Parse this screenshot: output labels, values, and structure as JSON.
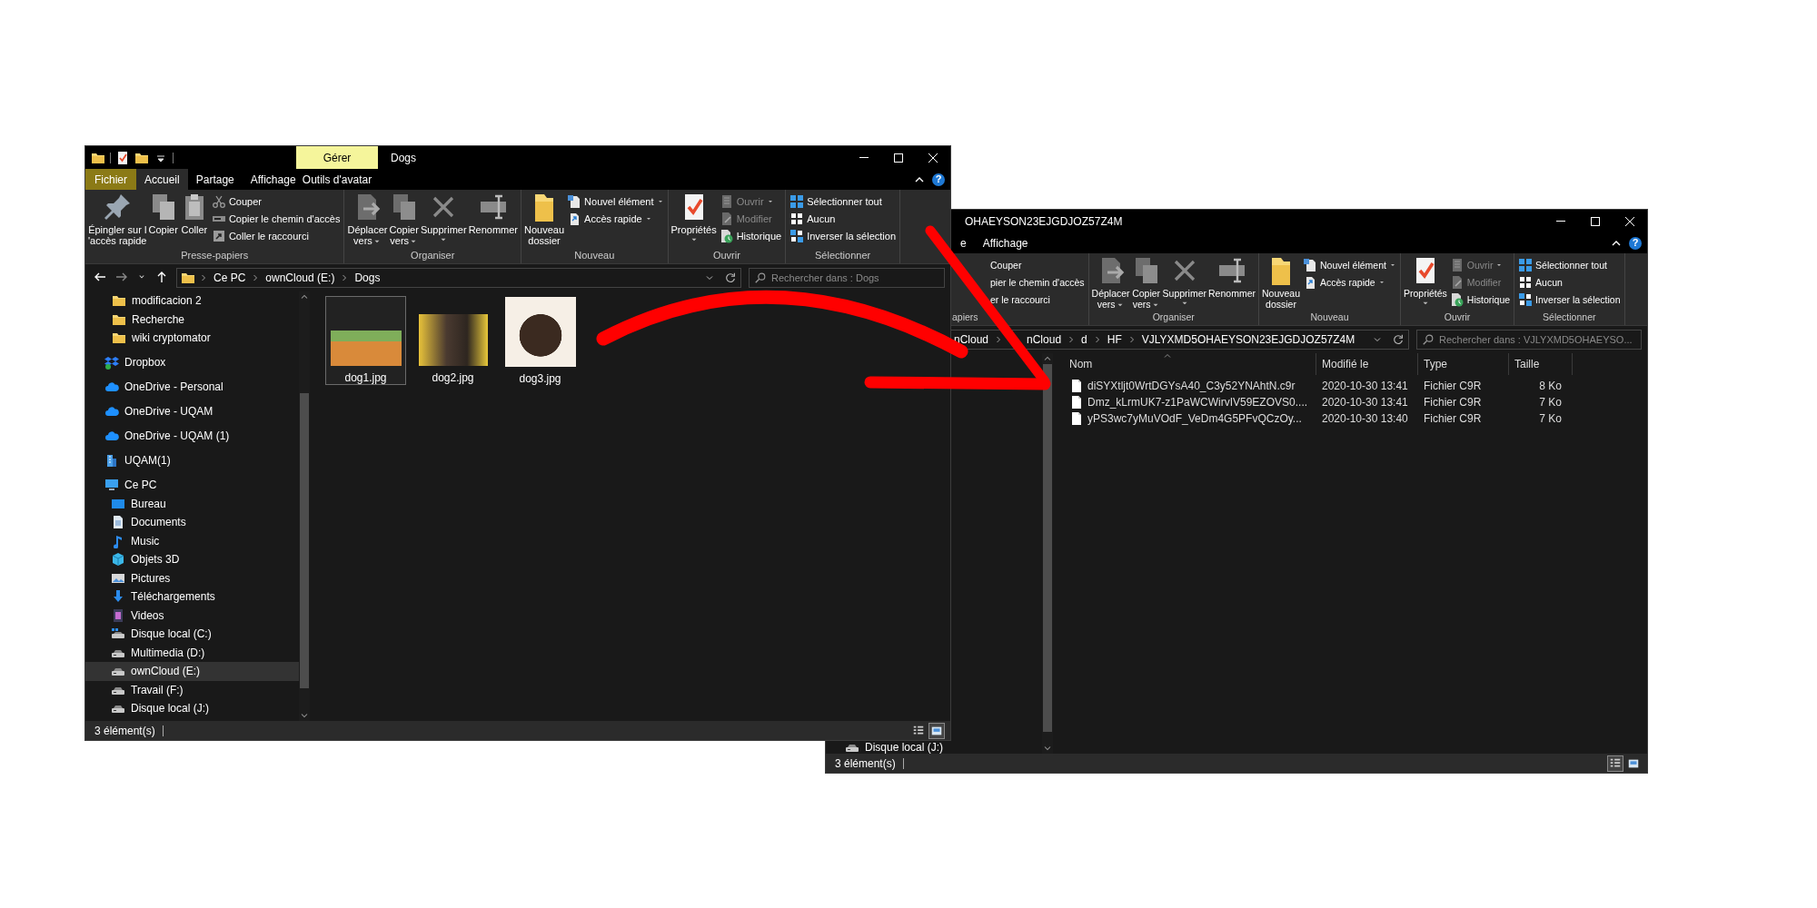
{
  "front_window": {
    "title": "Dogs",
    "context_tab": "Gérer",
    "help_button": "?",
    "tabs": [
      {
        "label": "Fichier",
        "kind": "file",
        "selected": false
      },
      {
        "label": "Accueil",
        "kind": "normal",
        "selected": true
      },
      {
        "label": "Partage",
        "kind": "normal",
        "selected": false
      },
      {
        "label": "Affichage",
        "kind": "normal",
        "selected": false
      },
      {
        "label": "Outils d'avatar",
        "kind": "context",
        "selected": false
      }
    ],
    "ribbon": [
      {
        "label": "Presse-papiers",
        "large": [
          {
            "label": "Épingler sur l\n'accès rapide",
            "kind": "pin",
            "dropdown": false,
            "disabled": false
          },
          {
            "label": "Copier",
            "kind": "copy",
            "dropdown": false,
            "disabled": false
          },
          {
            "label": "Coller",
            "kind": "paste",
            "dropdown": false,
            "disabled": false
          }
        ],
        "small": [
          {
            "label": "Couper",
            "kind": "cut",
            "dropdown": false,
            "disabled": false
          },
          {
            "label": "Copier le chemin d'accès",
            "kind": "path",
            "dropdown": false,
            "disabled": false
          },
          {
            "label": "Coller le raccourci",
            "kind": "shortcut",
            "dropdown": false,
            "disabled": false
          }
        ]
      },
      {
        "label": "Organiser",
        "large": [
          {
            "label": "Déplacer\nvers",
            "kind": "move",
            "dropdown": true,
            "disabled": false
          },
          {
            "label": "Copier\nvers",
            "kind": "copyto",
            "dropdown": true,
            "disabled": false
          },
          {
            "label": "Supprimer",
            "kind": "delete",
            "dropdown": true,
            "disabled": false
          },
          {
            "label": "Renommer",
            "kind": "rename",
            "dropdown": false,
            "disabled": false
          }
        ]
      },
      {
        "label": "Nouveau",
        "large": [
          {
            "label": "Nouveau\ndossier",
            "kind": "newfolder",
            "dropdown": false,
            "disabled": false
          }
        ],
        "small": [
          {
            "label": "Nouvel élément",
            "kind": "newitem",
            "dropdown": true,
            "disabled": false
          },
          {
            "label": "Accès rapide",
            "kind": "quick",
            "dropdown": true,
            "disabled": false
          }
        ]
      },
      {
        "label": "Ouvrir",
        "large": [
          {
            "label": "Propriétés",
            "kind": "props",
            "dropdown": true,
            "disabled": false
          }
        ],
        "small": [
          {
            "label": "Ouvrir",
            "kind": "open",
            "dropdown": true,
            "disabled": true
          },
          {
            "label": "Modifier",
            "kind": "edit",
            "dropdown": false,
            "disabled": true
          },
          {
            "label": "Historique",
            "kind": "history",
            "dropdown": false,
            "disabled": false
          }
        ]
      },
      {
        "label": "Sélectionner",
        "small": [
          {
            "label": "Sélectionner tout",
            "kind": "selall",
            "dropdown": false,
            "disabled": false
          },
          {
            "label": "Aucun",
            "kind": "selnone",
            "dropdown": false,
            "disabled": false
          },
          {
            "label": "Inverser la sélection",
            "kind": "selinv",
            "dropdown": false,
            "disabled": false
          }
        ]
      }
    ],
    "address": {
      "crumbs": [
        "Ce PC",
        "ownCloud (E:)",
        "Dogs"
      ]
    },
    "search": {
      "placeholder": "Rechercher dans : Dogs"
    },
    "nav": {
      "pinned": [
        {
          "label": "modificacion 2",
          "kind": "folder",
          "selected": false
        },
        {
          "label": "Recherche",
          "kind": "folder",
          "selected": false
        },
        {
          "label": "wiki cryptomator",
          "kind": "folder",
          "selected": false
        }
      ],
      "items": [
        {
          "label": "Dropbox",
          "kind": "dropbox",
          "selected": false
        },
        {
          "label": "OneDrive - Personal",
          "kind": "cloud",
          "selected": false
        },
        {
          "label": "OneDrive - UQAM",
          "kind": "cloud",
          "selected": false
        },
        {
          "label": "OneDrive - UQAM (1)",
          "kind": "cloud",
          "selected": false
        },
        {
          "label": "UQAM(1)",
          "kind": "building",
          "selected": false
        },
        {
          "label": "Ce PC",
          "kind": "pc",
          "selected": false,
          "children": [
            {
              "label": "Bureau",
              "kind": "desktop",
              "selected": false
            },
            {
              "label": "Documents",
              "kind": "documents",
              "selected": false
            },
            {
              "label": "Music",
              "kind": "music",
              "selected": false
            },
            {
              "label": "Objets 3D",
              "kind": "cube",
              "selected": false
            },
            {
              "label": "Pictures",
              "kind": "pictures",
              "selected": false
            },
            {
              "label": "Téléchargements",
              "kind": "download",
              "selected": false
            },
            {
              "label": "Videos",
              "kind": "videos",
              "selected": false
            },
            {
              "label": "Disque local (C:)",
              "kind": "drivewin",
              "selected": false
            },
            {
              "label": "Multimedia (D:)",
              "kind": "drive",
              "selected": false
            },
            {
              "label": "ownCloud (E:)",
              "kind": "drive",
              "selected": true
            },
            {
              "label": "Travail (F:)",
              "kind": "drive",
              "selected": false
            },
            {
              "label": "Disque local (J:)",
              "kind": "drive",
              "selected": false
            }
          ]
        }
      ]
    },
    "files": [
      {
        "name": "dog1.jpg",
        "selected": true
      },
      {
        "name": "dog2.jpg",
        "selected": false
      },
      {
        "name": "dog3.jpg",
        "selected": false
      }
    ],
    "status": "3 élément(s)",
    "views": [
      {
        "kind": "details",
        "selected": false
      },
      {
        "kind": "large_icons",
        "selected": true
      }
    ]
  },
  "back_window": {
    "title": "OHAEYSON23EJGDJOZ57Z4M",
    "help_button": "?",
    "tabs": [
      {
        "label": "e",
        "kind": "normal",
        "selected": false
      },
      {
        "label": "Affichage",
        "kind": "normal",
        "selected": false
      }
    ],
    "ribbon": [
      {
        "label": "apiers",
        "small": [
          {
            "label": "Couper",
            "kind": "none",
            "dropdown": false,
            "disabled": false
          },
          {
            "label": "pier le chemin d'accès",
            "kind": "none",
            "dropdown": false,
            "disabled": false
          },
          {
            "label": "er le raccourci",
            "kind": "none",
            "dropdown": false,
            "disabled": false
          }
        ]
      },
      {
        "label": "Organiser",
        "large": [
          {
            "label": "Déplacer\nvers",
            "kind": "move",
            "dropdown": true,
            "disabled": false
          },
          {
            "label": "Copier\nvers",
            "kind": "copyto",
            "dropdown": true,
            "disabled": false
          },
          {
            "label": "Supprimer",
            "kind": "delete",
            "dropdown": true,
            "disabled": false
          },
          {
            "label": "Renommer",
            "kind": "rename",
            "dropdown": false,
            "disabled": false
          }
        ]
      },
      {
        "label": "Nouveau",
        "large": [
          {
            "label": "Nouveau\ndossier",
            "kind": "newfolder",
            "dropdown": false,
            "disabled": false
          }
        ],
        "small": [
          {
            "label": "Nouvel élément",
            "kind": "newitem",
            "dropdown": true,
            "disabled": false
          },
          {
            "label": "Accès rapide",
            "kind": "quick",
            "dropdown": true,
            "disabled": false
          }
        ]
      },
      {
        "label": "Ouvrir",
        "large": [
          {
            "label": "Propriétés",
            "kind": "props",
            "dropdown": true,
            "disabled": false
          }
        ],
        "small": [
          {
            "label": "Ouvrir",
            "kind": "open",
            "dropdown": true,
            "disabled": true
          },
          {
            "label": "Modifier",
            "kind": "edit",
            "dropdown": false,
            "disabled": true
          },
          {
            "label": "Historique",
            "kind": "history",
            "dropdown": false,
            "disabled": false
          }
        ]
      },
      {
        "label": "Sélectionner",
        "small": [
          {
            "label": "Sélectionner tout",
            "kind": "selall",
            "dropdown": false,
            "disabled": false
          },
          {
            "label": "Aucun",
            "kind": "selnone",
            "dropdown": false,
            "disabled": false
          },
          {
            "label": "Inverser la sélection",
            "kind": "selinv",
            "dropdown": false,
            "disabled": false
          }
        ]
      }
    ],
    "address": {
      "crumbs": [
        "nCloud",
        "nCloud",
        "d",
        "HF",
        "VJLYXMD5OHAEYSON23EJGDJOZ57Z4M"
      ]
    },
    "search": {
      "placeholder": "Rechercher dans : VJLYXMD5OHAEYSO..."
    },
    "nav": {
      "items": [
        {
          "label": "Disque local (J:)",
          "kind": "drive",
          "selected": false
        }
      ]
    },
    "details": {
      "columns": [
        "Nom",
        "Modifié le",
        "Type",
        "Taille"
      ],
      "rows": [
        [
          "diSYXtljt0WrtDGYsA40_C3y52YNAhtN.c9r",
          "2020-10-30 13:41",
          "Fichier C9R",
          "8 Ko"
        ],
        [
          "Dmz_kLrmUK7-z1PaWCWirvIV59EZOVS0....",
          "2020-10-30 13:41",
          "Fichier C9R",
          "7 Ko"
        ],
        [
          "yPS3wc7yMuVOdF_VeDm4G5PFvQCzOy...",
          "2020-10-30 13:40",
          "Fichier C9R",
          "7 Ko"
        ]
      ]
    },
    "status": "3 élément(s)",
    "views": [
      {
        "kind": "details",
        "selected": true
      },
      {
        "kind": "large_icons",
        "selected": false
      }
    ]
  }
}
